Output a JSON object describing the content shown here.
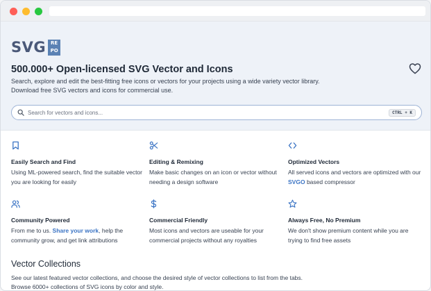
{
  "logo": {
    "text": "SVG",
    "badge_top": "RE",
    "badge_bottom": "PO"
  },
  "hero": {
    "title": "500.000+ Open-licensed SVG Vector and Icons",
    "description_line1": "Search, explore and edit the best-fitting free icons or vectors for your projects using a wide variety vector library.",
    "description_line2": "Download free SVG vectors and icons for commercial use."
  },
  "search": {
    "placeholder": "Search for vectors and icons...",
    "shortcut": "CTRL + K"
  },
  "features": [
    {
      "icon": "bookmark-icon",
      "title": "Easily Search and Find",
      "desc_pre": "Using ML-powered search, find the suitable vector you are looking for easily",
      "link": "",
      "desc_post": ""
    },
    {
      "icon": "scissors-icon",
      "title": "Editing & Remixing",
      "desc_pre": "Make basic changes on an icon or vector without needing a design software",
      "link": "",
      "desc_post": ""
    },
    {
      "icon": "code-icon",
      "title": "Optimized Vectors",
      "desc_pre": "All served icons and vectors are optimized with our",
      "link": "SVGO",
      "desc_post": "based compressor"
    },
    {
      "icon": "users-icon",
      "title": "Community Powered",
      "desc_pre": "From me to us.",
      "link": "Share your work",
      "desc_post": ", help the community grow, and get link attributions"
    },
    {
      "icon": "dollar-icon",
      "title": "Commercial Friendly",
      "desc_pre": "Most icons and vectors are useable for your commercial projects without any royalties",
      "link": "",
      "desc_post": ""
    },
    {
      "icon": "star-icon",
      "title": "Always Free, No Premium",
      "desc_pre": "We don't show premium content while you are trying to find free assets",
      "link": "",
      "desc_post": ""
    }
  ],
  "collections": {
    "title": "Vector Collections",
    "desc_line1": "See our latest featured vector collections, and choose the desired style of vector collections to list from the tabs.",
    "desc_line2": "Browse 6000+ collections of SVG icons by color and style."
  },
  "colors": {
    "accent": "#3b74c4",
    "logo": "#4a5878",
    "badge": "#5b82b4",
    "hero_bg": "#eef2f8"
  }
}
